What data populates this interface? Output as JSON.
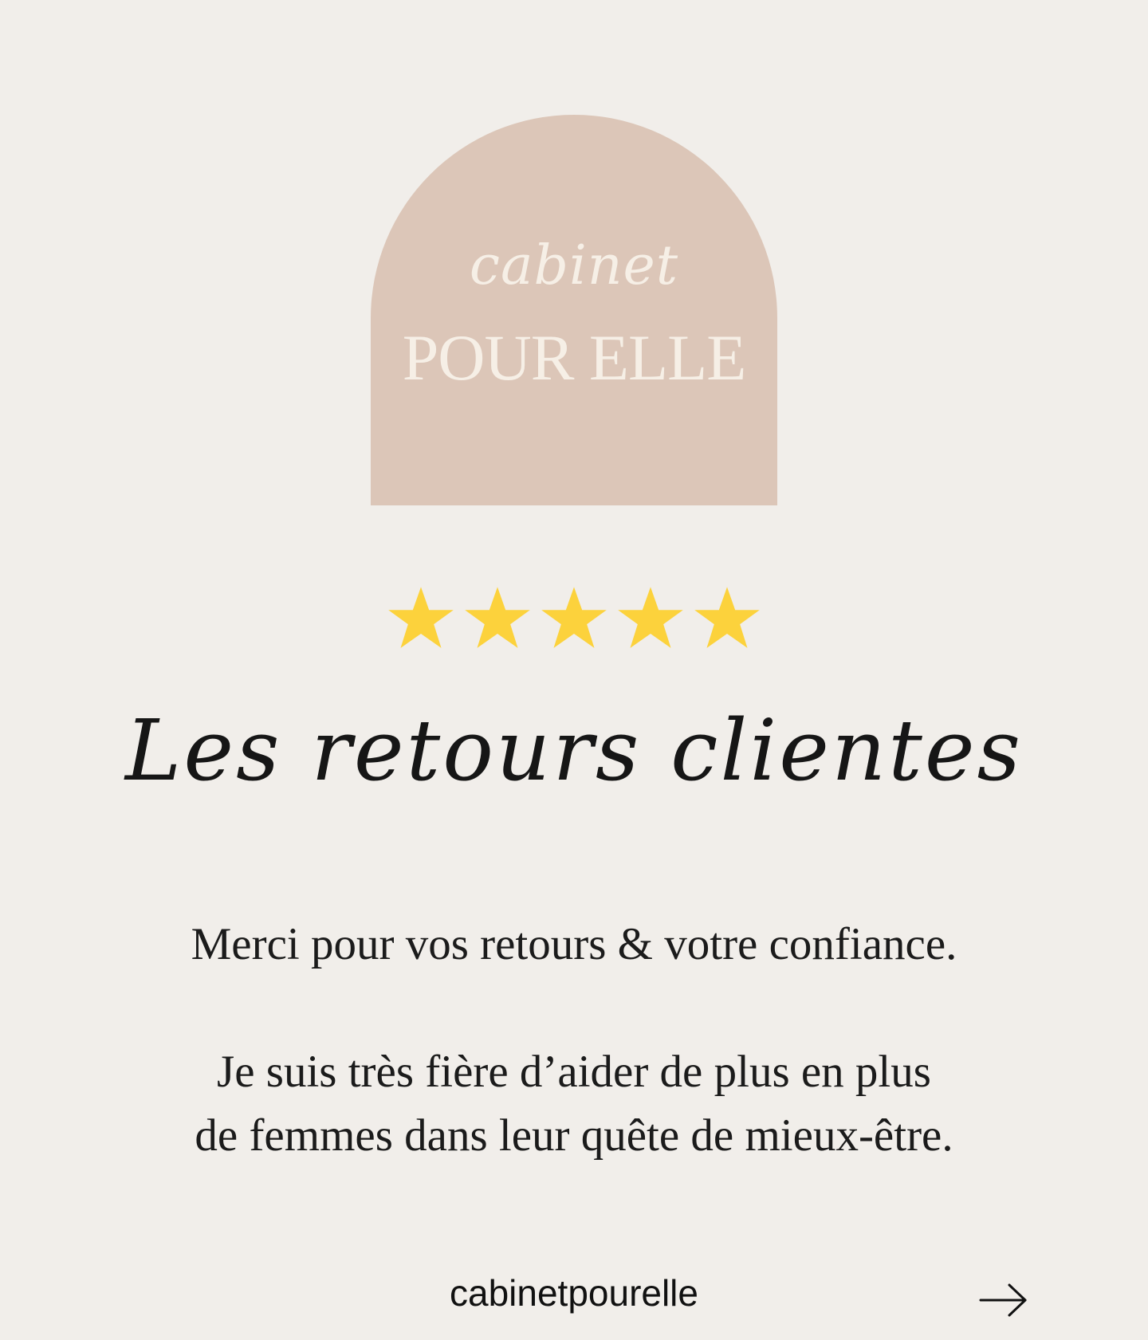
{
  "logo": {
    "script_text": "cabinet",
    "caps_text": "POUR ELLE"
  },
  "rating": {
    "stars_filled": 5,
    "stars_total": 5,
    "star_color": "#fcd23c"
  },
  "heading": "Les retours clientes",
  "message": {
    "line1": "Merci pour vos retours & votre confiance.",
    "line2": "Je suis très fière d’aider de plus en plus",
    "line3": "de femmes dans leur quête de mieux-être."
  },
  "footer": {
    "handle": "cabinetpourelle",
    "next_icon": "arrow-right-icon"
  },
  "colors": {
    "background": "#f1eeea",
    "arch": "#dcc6b8",
    "logo_text": "#f6efe6"
  }
}
